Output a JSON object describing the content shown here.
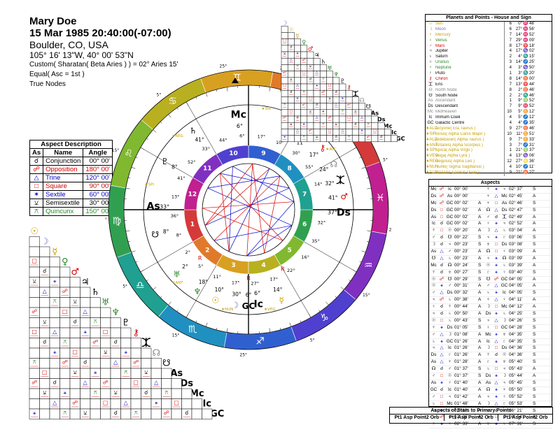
{
  "header": {
    "name": "Mary Doe",
    "datetime": "15 Mar 1985 20:40:00(-07:00)",
    "place": "Boulder, CO, USA",
    "coords": "105° 16' 13\"W, 40° 00' 53\"N",
    "ayanamsa": "Custom( Sharatan( Beta Aries ) ) = 02° Aries 15'",
    "house_system": "Equal( Asc = 1st )",
    "nodes": "True Nodes"
  },
  "aspect_legend": {
    "title": "Aspect Description",
    "columns": [
      "As",
      "Name",
      "Angle"
    ],
    "rows": [
      {
        "glyph": "☌",
        "name": "Conjunction",
        "angle": "00° 00'",
        "color": "#000000"
      },
      {
        "glyph": "☍",
        "name": "Opposition",
        "angle": "180° 00'",
        "color": "#d40000"
      },
      {
        "glyph": "△",
        "name": "Trine",
        "angle": "120° 00'",
        "color": "#0000c8"
      },
      {
        "glyph": "□",
        "name": "Square",
        "angle": "90° 00'",
        "color": "#d40000"
      },
      {
        "glyph": "✶",
        "name": "Sextile",
        "angle": "60° 00'",
        "color": "#0000c8"
      },
      {
        "glyph": "⚺",
        "name": "Semisextile",
        "angle": "30° 00'",
        "color": "#000000"
      },
      {
        "glyph": "⚻",
        "name": "Quincunx",
        "angle": "150° 00'",
        "color": "#2a8a2a"
      }
    ]
  },
  "planets_table": {
    "title": "Planets and Points - House and Sign",
    "rows": [
      {
        "sym": "☉",
        "name": "Sun",
        "house": "6",
        "deg": "0°",
        "sign": "♓",
        "min": "48'",
        "color": "#c8a000"
      },
      {
        "sym": "☽",
        "name": "Moon",
        "house": "6",
        "deg": "27°",
        "sign": "♓",
        "min": "56'",
        "color": "#7070c0"
      },
      {
        "sym": "☿",
        "name": "Mercury",
        "house": "7",
        "deg": "14°",
        "sign": "♓",
        "min": "52'",
        "color": "#c8a000"
      },
      {
        "sym": "♀",
        "name": "Venus",
        "house": "7",
        "deg": "29°",
        "sign": "♓",
        "min": "09'",
        "color": "#2a8a2a"
      },
      {
        "sym": "♂",
        "name": "Mars",
        "house": "8",
        "deg": "17°",
        "sign": "♈",
        "min": "18'",
        "color": "#d40000"
      },
      {
        "sym": "♃",
        "name": "Jupiter",
        "house": "4",
        "deg": "17°",
        "sign": "♑",
        "min": "02'",
        "color": "#000000"
      },
      {
        "sym": "♄",
        "name": "Saturn",
        "house": "2",
        "deg": "4°",
        "sign": "♏",
        "min": "15'",
        "color": "#000000"
      },
      {
        "sym": "♅",
        "name": "Uranus",
        "house": "3",
        "deg": "14°",
        "sign": "♐",
        "min": "25'",
        "color": "#2a8a2a"
      },
      {
        "sym": "♆",
        "name": "Neptune",
        "house": "4",
        "deg": "3°",
        "sign": "♑",
        "min": "50'",
        "color": "#2a8a2a"
      },
      {
        "sym": "♇",
        "name": "Pluto",
        "house": "1",
        "deg": "3°",
        "sign": "♏",
        "min": "20'",
        "color": "#000000"
      },
      {
        "sym": "⚷",
        "name": "Chiron",
        "house": "8",
        "deg": "14°",
        "sign": "♉",
        "min": "00'",
        "color": "#d40000"
      },
      {
        "sym": "⯰",
        "name": "Eris",
        "house": "7",
        "deg": "13°",
        "sign": "♈",
        "min": "44'",
        "color": "#000000"
      },
      {
        "sym": "☊",
        "name": "North Node",
        "house": "8",
        "deg": "2°",
        "sign": "♉",
        "min": "46'",
        "color": "#888888"
      },
      {
        "sym": "☋",
        "name": "South Node",
        "house": "2",
        "deg": "2°",
        "sign": "♏",
        "min": "46'",
        "color": "#000000"
      },
      {
        "sym": "As",
        "name": "Ascendant",
        "house": "1",
        "deg": "9°",
        "sign": "♍",
        "min": "52'",
        "color": "#888888"
      },
      {
        "sym": "Ds",
        "name": "Descendant",
        "house": "7",
        "deg": "9°",
        "sign": "♓",
        "min": "52'",
        "color": "#000000"
      },
      {
        "sym": "Mc",
        "name": "MidHeaven",
        "house": "10",
        "deg": "5°",
        "sign": "♊",
        "min": "12'",
        "color": "#888888"
      },
      {
        "sym": "Ic",
        "name": "Immum Coeli",
        "house": "4",
        "deg": "5°",
        "sign": "♐",
        "min": "12'",
        "color": "#000000"
      },
      {
        "sym": "GC",
        "name": "Galactic Centre",
        "house": "4",
        "deg": "4°",
        "sign": "♐",
        "min": "35'",
        "color": "#000000"
      },
      {
        "sym": "★ALC",
        "name": "Alcyone( Eta Taurus )",
        "house": "9",
        "deg": "27°",
        "sign": "♉",
        "min": "46'",
        "color": "#c8a000"
      },
      {
        "sym": "★SIR",
        "name": "Sirius( Alpha Canis Major )",
        "house": "10",
        "deg": "11°",
        "sign": "♊",
        "min": "51'",
        "color": "#c8a000"
      },
      {
        "sym": "★ALD",
        "name": "Aldebaran( Alpha Taurus )",
        "house": "9",
        "deg": "7°",
        "sign": "♊",
        "min": "33'",
        "color": "#c8a000"
      },
      {
        "sym": "★ANT",
        "name": "Antares( Alpha Scorpius )",
        "house": "3",
        "deg": "7°",
        "sign": "♐",
        "min": "31'",
        "color": "#c8a000"
      },
      {
        "sym": "★SPI",
        "name": "Spica( Alpha Virgo )",
        "house": "1",
        "deg": "21°",
        "sign": "♍",
        "min": "37'",
        "color": "#c8a000"
      },
      {
        "sym": "★VEG",
        "name": "Vega( Alpha Lyra )",
        "house": "4",
        "deg": "13°",
        "sign": "♑",
        "min": "06'",
        "color": "#c8a000"
      },
      {
        "sym": "★REG",
        "name": "Regulus( Alpha Leo )",
        "house": "12",
        "deg": "27°",
        "sign": "♌",
        "min": "36'",
        "color": "#c8a000"
      },
      {
        "sym": "★NUN",
        "name": "Nunki( Sigma Sagittarius )",
        "house": "4",
        "deg": "10°",
        "sign": "♐",
        "min": "11'",
        "color": "#c8a000"
      },
      {
        "sym": "★ALN",
        "name": "Alnilam( Epsilon Orion )",
        "house": "9",
        "deg": "21°",
        "sign": "♉",
        "min": "27'",
        "color": "#c8a000"
      }
    ]
  },
  "aspects_list": {
    "title": "Aspects",
    "rows": [
      {
        "p1": "Mc",
        "a": "☍",
        "p2": "Ic",
        "orb": "00° 00'",
        "t": "",
        "p3": "☿",
        "b": "⚹",
        "p4": "♃",
        "orb2": "02° 37'",
        "t2": "S"
      },
      {
        "p1": "Ds",
        "a": "☍",
        "p2": "As",
        "orb": "00° 00'",
        "t": "",
        "p3": "♆",
        "b": "△",
        "p4": "Mc",
        "orb2": "02° 45'",
        "t2": "A"
      },
      {
        "p1": "Mc",
        "a": "☍",
        "p2": "GC",
        "orb": "00° 02'",
        "t": "A",
        "p3": "♆",
        "b": "□",
        "p4": "As",
        "orb2": "02° 46'",
        "t2": "S"
      },
      {
        "p1": "Ds",
        "a": "□",
        "p2": "GC",
        "orb": "00° 02'",
        "t": "A",
        "p3": "☊",
        "b": "△",
        "p4": "Ds",
        "orb2": "02° 47'",
        "t2": "S"
      },
      {
        "p1": "As",
        "a": "□",
        "p2": "GC",
        "orb": "00° 02'",
        "t": "A",
        "p3": "♂",
        "b": "☌",
        "p4": "⯰",
        "orb2": "02° 49'",
        "t2": "A"
      },
      {
        "p1": "Ic",
        "a": "☌",
        "p2": "GC",
        "orb": "00° 02'",
        "t": "A",
        "p3": "♀",
        "b": "⚹",
        "p4": "♃",
        "orb2": "02° 52'",
        "t2": "A"
      },
      {
        "p1": "☿",
        "a": "□",
        "p2": "☉",
        "orb": "00° 20'",
        "t": "A",
        "p3": "☽",
        "b": "△",
        "p4": "♄",
        "orb2": "03° 04'",
        "t2": "A"
      },
      {
        "p1": "♂",
        "a": "☌",
        "p2": "☋",
        "orb": "00° 22'",
        "t": "S",
        "p3": "♃",
        "b": "⚹",
        "p4": "♇",
        "orb2": "03° 06'",
        "t2": "S"
      },
      {
        "p1": "☽",
        "a": "☌",
        "p2": "♃",
        "orb": "00° 23'",
        "t": "S",
        "p3": "♅",
        "b": "□",
        "p4": "Ds",
        "orb2": "03° 08'",
        "t2": "S"
      },
      {
        "p1": "As",
        "a": "△",
        "p2": "♂",
        "orb": "00° 23'",
        "t": "A",
        "p3": "☊",
        "b": "□",
        "p4": "♀",
        "orb2": "03° 09'",
        "t2": "A"
      },
      {
        "p1": "☋",
        "a": "△",
        "p2": "♄",
        "orb": "00° 23'",
        "t": "A",
        "p3": "♃",
        "b": "⚹",
        "p4": "☊",
        "orb2": "03° 09'",
        "t2": "A"
      },
      {
        "p1": "Mc",
        "a": "☌",
        "p2": "☊",
        "orb": "00° 24'",
        "t": "S",
        "p3": "☉",
        "b": "⚹",
        "p4": "♄",
        "orb2": "03° 39'",
        "t2": "A"
      },
      {
        "p1": "☿",
        "a": "☌",
        "p2": "♅",
        "orb": "00° 27'",
        "t": "S",
        "p3": "♇",
        "b": "⚹",
        "p4": "♀",
        "orb2": "03° 40'",
        "t2": "S"
      },
      {
        "p1": "☉",
        "a": "☍",
        "p2": "☋",
        "orb": "00° 29'",
        "t": "S",
        "p3": "☋",
        "b": "☍",
        "p4": "GC",
        "orb2": "04° 05'",
        "t2": "A"
      },
      {
        "p1": "☉",
        "a": "⚹",
        "p2": "♂",
        "orb": "00° 31'",
        "t": "A",
        "p3": "♂",
        "b": "△",
        "p4": "GC",
        "orb2": "04° 05'",
        "t2": "A"
      },
      {
        "p1": "♂",
        "a": "△",
        "p2": "Ds",
        "orb": "00° 32'",
        "t": "A",
        "p3": "♄",
        "b": "⚹",
        "p4": "Ic",
        "orb2": "04° 05'",
        "t2": "S"
      },
      {
        "p1": "♃",
        "a": "☍",
        "p2": "♄",
        "orb": "00° 38'",
        "t": "A",
        "p3": "♆",
        "b": "△",
        "p4": "♀",
        "orb2": "04° 11'",
        "t2": "A"
      },
      {
        "p1": "♀",
        "a": "☌",
        "p2": "☿",
        "orb": "00° 44'",
        "t": "A",
        "p3": "☽",
        "b": "□",
        "p4": "Mc",
        "orb2": "04° 12'",
        "t2": "A"
      },
      {
        "p1": "♃",
        "a": "☌",
        "p2": "♄",
        "orb": "00° 50'",
        "t": "A",
        "p3": "Ds",
        "b": "⚹",
        "p4": "♄",
        "orb2": "04° 25'",
        "t2": "S"
      },
      {
        "p1": "☉",
        "a": "□",
        "p2": "♄",
        "orb": "00° 43'",
        "t": "S",
        "p3": "♃",
        "b": "△",
        "p4": "☽",
        "orb2": "04° 26'",
        "t2": "S"
      },
      {
        "p1": "♆",
        "a": "⚹",
        "p2": "Ds",
        "orb": "01° 05'",
        "t": "S",
        "p3": "♀",
        "b": "□",
        "p4": "GC",
        "orb2": "04° 28'",
        "t2": "S"
      },
      {
        "p1": "♂",
        "a": "△",
        "p2": "☽",
        "orb": "01° 08'",
        "t": "A",
        "p3": "Mc",
        "b": "⚹",
        "p4": "♅",
        "orb2": "04° 35'",
        "t2": "S"
      },
      {
        "p1": "♄",
        "a": "⚹",
        "p2": "GC",
        "orb": "01° 26'",
        "t": "A",
        "p3": "Ic",
        "b": "△",
        "p4": "♇",
        "orb2": "04° 35'",
        "t2": "S"
      },
      {
        "p1": "♃",
        "a": "△",
        "p2": "Ic",
        "orb": "01° 26'",
        "t": "A",
        "p3": "☽",
        "b": "□",
        "p4": "Ds",
        "orb2": "04° 36'",
        "t2": "S"
      },
      {
        "p1": "Ds",
        "a": "△",
        "p2": "♇",
        "orb": "01° 26'",
        "t": "A",
        "p3": "☿",
        "b": "☌",
        "p4": "☉",
        "orb2": "04° 36'",
        "t2": "S"
      },
      {
        "p1": "As",
        "a": "△",
        "p2": "♆",
        "orb": "01° 28'",
        "t": "A",
        "p3": "♇",
        "b": "⚹",
        "p4": "♅",
        "orb2": "05° 40'",
        "t2": "S"
      },
      {
        "p1": "☊",
        "a": "☌",
        "p2": "♂",
        "orb": "01° 37'",
        "t": "S",
        "p3": "♄",
        "b": "□",
        "p4": "♃",
        "orb2": "05° 43'",
        "t2": "A"
      },
      {
        "p1": "♂",
        "a": "□",
        "p2": "☉",
        "orb": "01° 37'",
        "t": "S",
        "p3": "Ds",
        "b": "⚹",
        "p4": "☽",
        "orb2": "05° 44'",
        "t2": "A"
      },
      {
        "p1": "As",
        "a": "⚹",
        "p2": "♀",
        "orb": "01° 40'",
        "t": "A",
        "p3": "As",
        "b": "△",
        "p4": "♃",
        "orb2": "05° 45'",
        "t2": "S"
      },
      {
        "p1": "GC",
        "a": "☌",
        "p2": "Ic",
        "orb": "01° 40'",
        "t": "A",
        "p3": "☊",
        "b": "⚹",
        "p4": "♆",
        "orb2": "05° 50'",
        "t2": "S"
      },
      {
        "p1": "♂",
        "a": "□",
        "p2": "♃",
        "orb": "01° 42'",
        "t": "A",
        "p3": "♃",
        "b": "⚹",
        "p4": "♀",
        "orb2": "05° 52'",
        "t2": "S"
      },
      {
        "p1": "♄",
        "a": "□",
        "p2": "Mc",
        "orb": "01° 48'",
        "t": "A",
        "p3": "☽",
        "b": "△",
        "p4": "♇",
        "orb2": "05° 53'",
        "t2": "S"
      },
      {
        "p1": "As",
        "a": "⚹",
        "p2": "☉",
        "orb": "02° 19'",
        "t": "A",
        "p3": "♇",
        "b": "☌",
        "p4": "♄",
        "orb2": "06° 21'",
        "t2": "S"
      },
      {
        "p1": "♄",
        "a": "☍",
        "p2": "♃",
        "orb": "02° 28'",
        "t": "A",
        "p3": "♅",
        "b": "□",
        "p4": "☽",
        "orb2": "06° 54'",
        "t2": "A"
      },
      {
        "p1": "♆",
        "a": "⚹",
        "p2": "♀",
        "orb": "02° 33'",
        "t": "A",
        "p3": "♅",
        "b": "⚹",
        "p4": "♄",
        "orb2": "07° 31'",
        "t2": "S"
      }
    ]
  },
  "stars_aspects": {
    "title": "Aspects of Stars to Primary Points",
    "headers": [
      "Pt1  Asp Point2 Orb",
      "Pt1  Asp Point2 Orb",
      "Pt1  Asp Point2 Orb"
    ]
  },
  "wheel": {
    "angle_labels": {
      "mc": "Mc",
      "ic": "Ic",
      "as": "As",
      "ds": "Ds"
    },
    "mc_deg": "6°",
    "ic_deg": "6°",
    "as_deg": "33°",
    "ds_deg": "37°",
    "sign_glyphs": [
      "♈",
      "♉",
      "♊",
      "♋",
      "♌",
      "♍",
      "♎",
      "♏",
      "♐",
      "♑",
      "♒",
      "♓"
    ],
    "sign_colors": [
      "#d43a3a",
      "#e07a2a",
      "#d8a020",
      "#b8b020",
      "#80b830",
      "#30a050",
      "#20a090",
      "#2090c0",
      "#3060d0",
      "#5040d0",
      "#8030c0",
      "#c02090"
    ],
    "house_numbers": [
      "1",
      "2",
      "3",
      "4",
      "5",
      "6",
      "7",
      "8",
      "9",
      "10",
      "11",
      "12"
    ],
    "house_colors": [
      "#d43a3a",
      "#e07a2a",
      "#d8a020",
      "#b8b020",
      "#80b830",
      "#30a050",
      "#20a090",
      "#2090c0",
      "#3060d0",
      "#5040d0",
      "#8030c0",
      "#c02090"
    ],
    "planet_marks": [
      {
        "g": "♂",
        "deg": "41°",
        "color": "#d40000"
      },
      {
        "g": "⯰",
        "deg": "32°",
        "color": "#000000"
      },
      {
        "g": "☊",
        "deg": "24°",
        "color": "#888888"
      },
      {
        "g": "⚷",
        "deg": "17°",
        "color": "#d40000"
      },
      {
        "g": "♀",
        "deg": "11°",
        "color": "#2a8a2a"
      },
      {
        "g": "♃",
        "deg": "5°",
        "color": "#000000"
      },
      {
        "g": "♄",
        "deg": "41°",
        "color": "#000000"
      },
      {
        "g": "♇",
        "deg": "8°",
        "color": "#000000"
      },
      {
        "g": "☋",
        "deg": "8°",
        "color": "#000000"
      },
      {
        "g": "♅",
        "deg": "2°",
        "color": "#2a8a2a"
      },
      {
        "g": "♆",
        "deg": "18°",
        "color": "#2a8a2a"
      },
      {
        "g": "☉",
        "deg": "10°",
        "color": "#c8a000"
      },
      {
        "g": "☽",
        "deg": "30°",
        "color": "#7070c0"
      },
      {
        "g": "☿",
        "deg": "14°",
        "color": "#c8a000"
      },
      {
        "g": "GC",
        "deg": "6°",
        "color": "#000000"
      }
    ],
    "star_marks": [
      "★SIR",
      "★ALD",
      "★ALC",
      "★ALN",
      "★REG",
      "★SPI",
      "★ANT",
      "★NUN",
      "★VEG"
    ],
    "outer_deg_labels": [
      "25°",
      "5°",
      "15°",
      "25°",
      "5°",
      "15°",
      "25°",
      "5°",
      "15°",
      "25°",
      "5°",
      "15°",
      "25°"
    ],
    "inner_deg_labels": [
      "14°",
      "55°",
      "30°",
      "10°",
      "17°",
      "6°",
      "44°",
      "33°",
      "52°",
      "41°",
      "13°",
      "36°",
      "8°",
      "2°",
      "5°",
      "11°",
      "17°",
      "27°",
      "17°",
      "22°",
      "16°",
      "35°",
      "32°"
    ]
  },
  "left_grid": {
    "glyphs": [
      "☉",
      "☽",
      "☿",
      "♀",
      "♂",
      "♃",
      "♄",
      "♅",
      "♆",
      "♇",
      "⚷",
      "⯰",
      "☊",
      "☋",
      "As",
      "Ds",
      "Mc",
      "Ic",
      "GC"
    ],
    "glyph_colors": [
      "#c8a000",
      "#7070c0",
      "#c8a000",
      "#2a8a2a",
      "#d40000",
      "#000000",
      "#000000",
      "#2a8a2a",
      "#2a8a2a",
      "#000000",
      "#d40000",
      "#000000",
      "#888888",
      "#000000",
      "#000000",
      "#000000",
      "#000000",
      "#000000",
      "#000000"
    ]
  },
  "right_grid": {
    "glyphs": [
      "☽",
      "☉",
      "☿",
      "♀",
      "♂",
      "♃",
      "♄",
      "♅",
      "♆",
      "♇",
      "⚷",
      "⯰",
      "☊",
      "☋",
      "As",
      "Ds",
      "Mc",
      "Ic",
      "GC"
    ],
    "glyph_colors": [
      "#7070c0",
      "#c8a000",
      "#c8a000",
      "#2a8a2a",
      "#d40000",
      "#000000",
      "#000000",
      "#2a8a2a",
      "#2a8a2a",
      "#000000",
      "#d40000",
      "#000000",
      "#888888",
      "#000000",
      "#000000",
      "#000000",
      "#000000",
      "#000000",
      "#000000"
    ]
  }
}
